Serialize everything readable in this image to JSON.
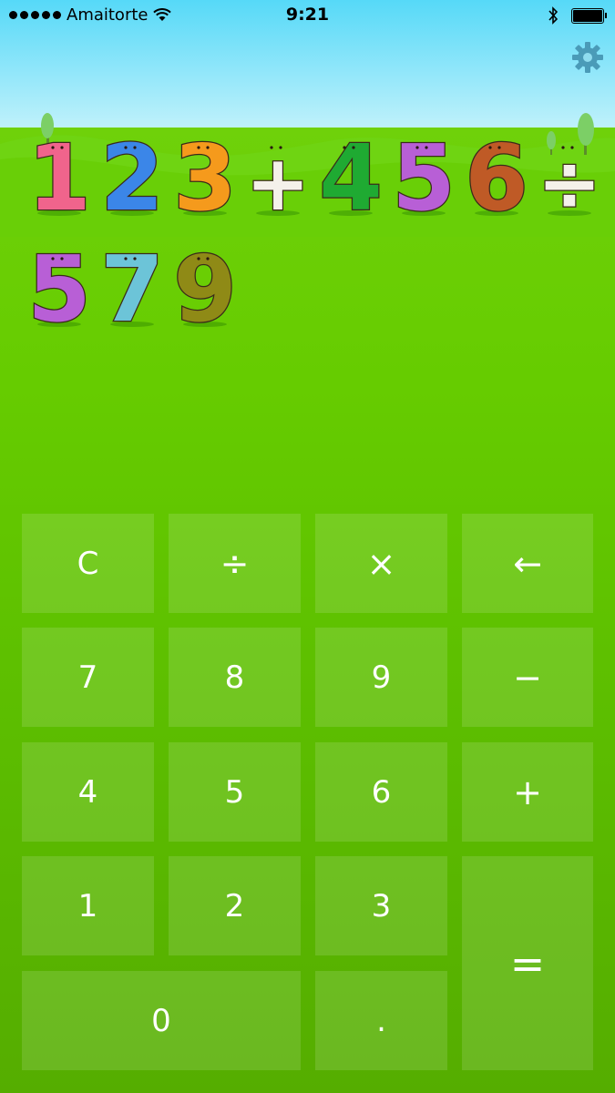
{
  "status_bar": {
    "carrier": "Amaitorte",
    "time": "9:21",
    "icons": [
      "signal-dots",
      "wifi-icon",
      "bluetooth-icon",
      "battery-icon"
    ]
  },
  "settings": {
    "icon": "gear-icon",
    "color": "#4a9bb8"
  },
  "display": {
    "value": "123+456÷579",
    "characters": [
      {
        "char": "1",
        "color": "#f0648c"
      },
      {
        "char": "2",
        "color": "#3b86e8"
      },
      {
        "char": "3",
        "color": "#f59a1c"
      },
      {
        "char": "+",
        "color": "#f4f1ea"
      },
      {
        "char": "4",
        "color": "#1faa32"
      },
      {
        "char": "5",
        "color": "#b85fd6"
      },
      {
        "char": "6",
        "color": "#bf5a26"
      },
      {
        "char": "÷",
        "color": "#f4f1ea"
      },
      {
        "char": "5",
        "color": "#b85fd6"
      },
      {
        "char": "7",
        "color": "#6cc4d8"
      },
      {
        "char": "9",
        "color": "#8f8a16"
      }
    ]
  },
  "keypad": {
    "clear": "C",
    "divide": "÷",
    "multiply": "×",
    "backspace": "←",
    "seven": "7",
    "eight": "8",
    "nine": "9",
    "minus": "−",
    "four": "4",
    "five": "5",
    "six": "6",
    "plus": "+",
    "one": "1",
    "two": "2",
    "three": "3",
    "equals": "=",
    "zero": "0",
    "decimal": "."
  },
  "colors": {
    "sky_top": "#56d9f8",
    "grass": "#66cc00",
    "key_tint": "rgba(255,255,255,0.13)",
    "key_text": "#ffffff"
  }
}
